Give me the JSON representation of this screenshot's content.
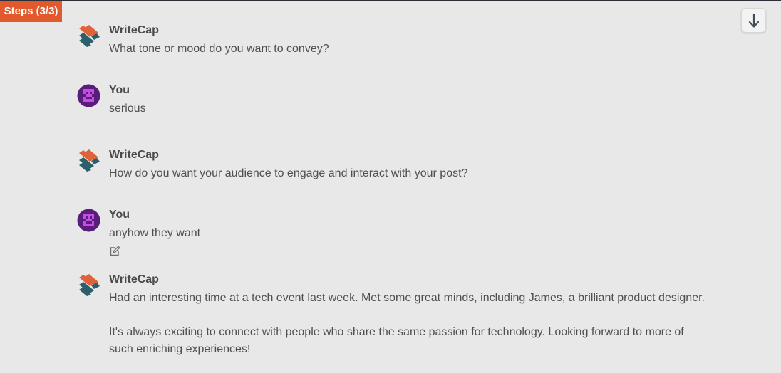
{
  "steps_badge": "Steps (3/3)",
  "scroll_button": {
    "icon": "arrow-down-icon"
  },
  "colors": {
    "badge": "#e2592d",
    "background": "#e8e8e8",
    "user_avatar": "#5b1d7a",
    "logo_orange": "#e0623a",
    "logo_teal": "#2b5f6b"
  },
  "messages": [
    {
      "author": "WriteCap",
      "avatar": "writecap-logo-icon",
      "text": "What tone or mood do you want to convey?"
    },
    {
      "author": "You",
      "avatar": "user-avatar-icon",
      "text": "serious"
    },
    {
      "author": "WriteCap",
      "avatar": "writecap-logo-icon",
      "text": "How do you want your audience to engage and interact with your post?"
    },
    {
      "author": "You",
      "avatar": "user-avatar-icon",
      "text": "anyhow they want",
      "edit_icon": "edit-icon"
    },
    {
      "author": "WriteCap",
      "avatar": "writecap-logo-icon",
      "text_line1": "Had an interesting time at a tech event last week. Met some great minds, including James, a brilliant product designer.",
      "text_line2": "It's always exciting to connect with people who share the same passion for technology. Looking forward to more of",
      "text_line3": "such enriching experiences!"
    }
  ]
}
